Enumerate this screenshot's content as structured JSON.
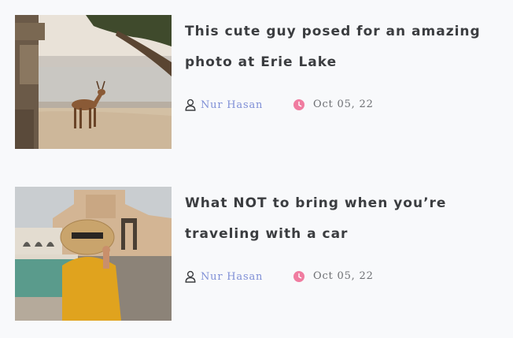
{
  "posts": [
    {
      "title": "This cute guy posed for an amazing photo at Erie Lake",
      "author": "Nur Hasan",
      "date": "Oct 05, 22",
      "image": "deer-at-lake-photo"
    },
    {
      "title": "What NOT to bring when you’re traveling with a car",
      "author": "Nur Hasan",
      "date": "Oct 05, 22",
      "image": "woman-with-straw-hat-photo"
    }
  ],
  "icons": {
    "author": "user-icon",
    "date": "clock-icon"
  },
  "colors": {
    "title": "#3b3d40",
    "author": "#7f8fd6",
    "date_icon": "#f07ca0",
    "date_text": "#6d6f73",
    "background": "#f8f9fb"
  }
}
